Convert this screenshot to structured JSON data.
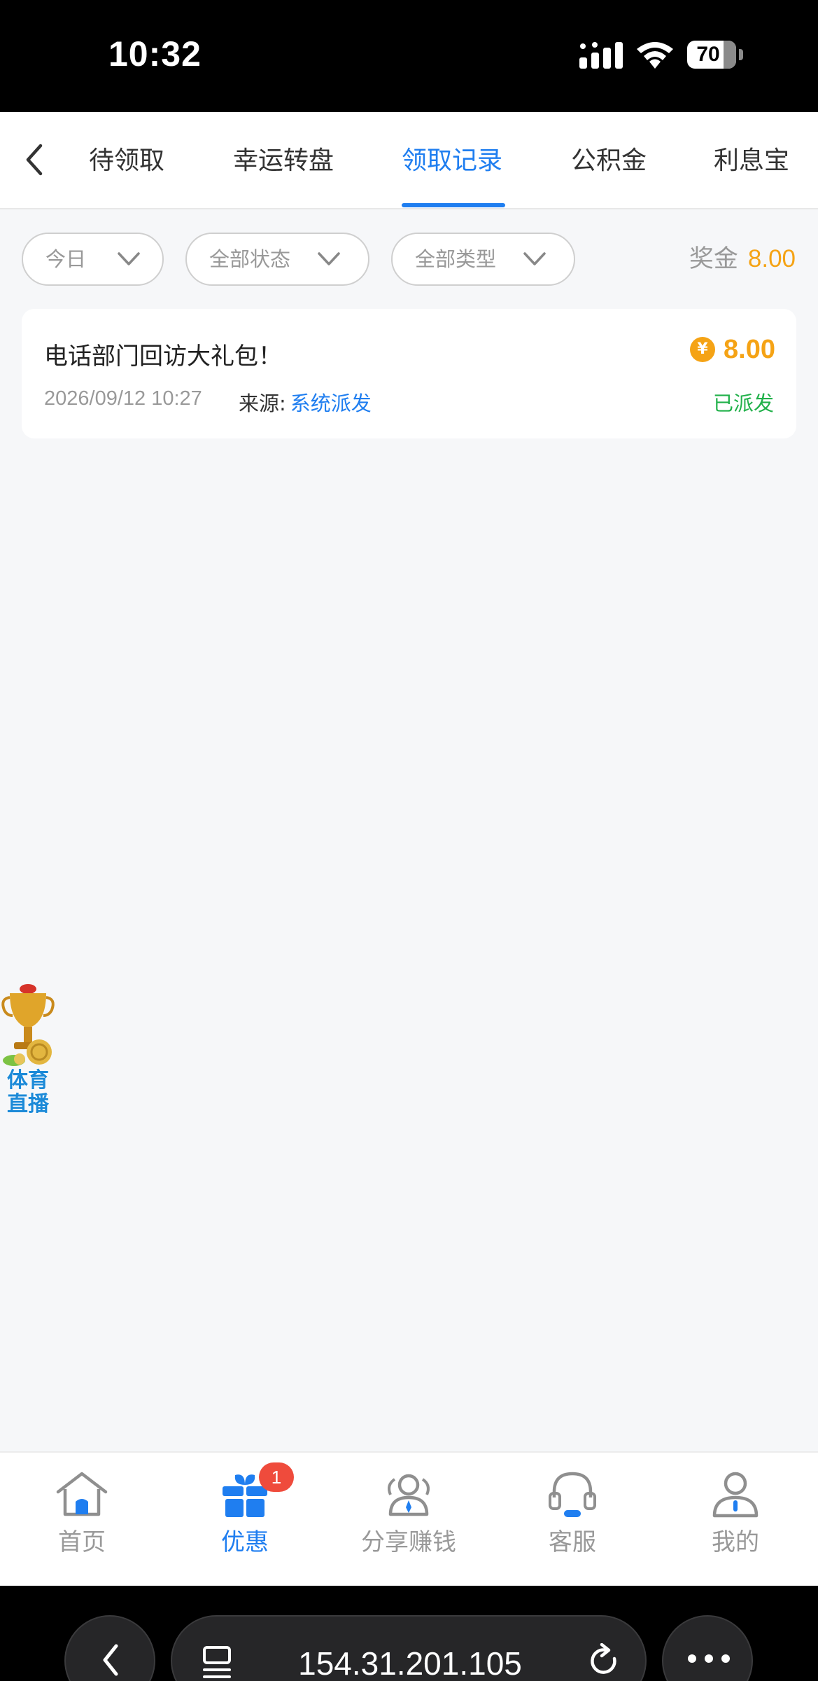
{
  "status_bar": {
    "time": "10:32",
    "battery": "70"
  },
  "tabs": [
    {
      "label": "待领取"
    },
    {
      "label": "幸运转盘"
    },
    {
      "label": "领取记录"
    },
    {
      "label": "公积金"
    },
    {
      "label": "利息宝"
    }
  ],
  "active_tab": "领取记录",
  "filters": {
    "date": "今日",
    "status": "全部状态",
    "type": "全部类型"
  },
  "bonus": {
    "label": "奖金",
    "amount": "8.00"
  },
  "records": [
    {
      "title": "电话部门回访大礼包！",
      "currency_symbol": "¥",
      "amount": "8.00",
      "datetime": "2026/09/12 10:27",
      "source_label": "来源:",
      "source": "系统派发",
      "status": "已派发"
    }
  ],
  "floating_widget": {
    "line1": "体育",
    "line2": "直播"
  },
  "bottom_nav": [
    {
      "label": "首页",
      "icon": "home-icon"
    },
    {
      "label": "优惠",
      "icon": "gift-icon",
      "badge": "1",
      "active": true
    },
    {
      "label": "分享赚钱",
      "icon": "share-users-icon"
    },
    {
      "label": "客服",
      "icon": "headset-icon"
    },
    {
      "label": "我的",
      "icon": "user-icon"
    }
  ],
  "browser": {
    "url": "154.31.201.105"
  },
  "colors": {
    "accent": "#1f7ef0",
    "amount": "#f5a315",
    "success": "#21b14a",
    "badge": "#ef4b3c"
  }
}
